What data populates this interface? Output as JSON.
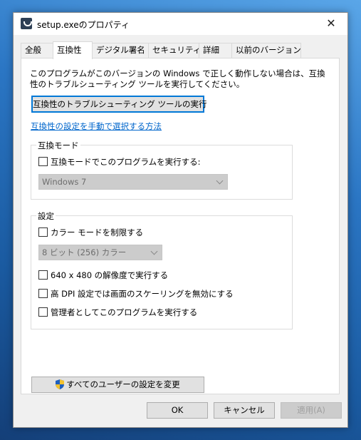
{
  "window": {
    "title": "setup.exeのプロパティ",
    "close_label": "✕"
  },
  "tabs": [
    {
      "label": "全般"
    },
    {
      "label": "互換性"
    },
    {
      "label": "デジタル署名"
    },
    {
      "label": "セキュリティ"
    },
    {
      "label": "詳細"
    },
    {
      "label": "以前のバージョン"
    }
  ],
  "compat": {
    "description": "このプログラムがこのバージョンの Windows で正しく動作しない場合は、互換性のトラブルシューティング ツールを実行してください。",
    "troubleshoot_button": "互換性のトラブルシューティング ツールの実行",
    "manual_link": "互換性の設定を手動で選択する方法",
    "mode_group": {
      "label": "互換モード",
      "checkbox_label": "互換モードでこのプログラムを実行する:",
      "os_selected": "Windows 7"
    },
    "settings_group": {
      "label": "設定",
      "reduced_color_label": "カラー モードを制限する",
      "color_selected": "8 ビット (256) カラー",
      "res_640_label": "640 x 480 の解像度で実行する",
      "dpi_label": "高 DPI 設定では画面のスケーリングを無効にする",
      "admin_label": "管理者としてこのプログラムを実行する"
    },
    "all_users_button": "すべてのユーザーの設定を変更"
  },
  "footer": {
    "ok": "OK",
    "cancel": "キャンセル",
    "apply": "適用(A)"
  },
  "colors": {
    "accent": "#0078d7",
    "link": "#0066cc",
    "desktop": "#1b5fa8"
  }
}
